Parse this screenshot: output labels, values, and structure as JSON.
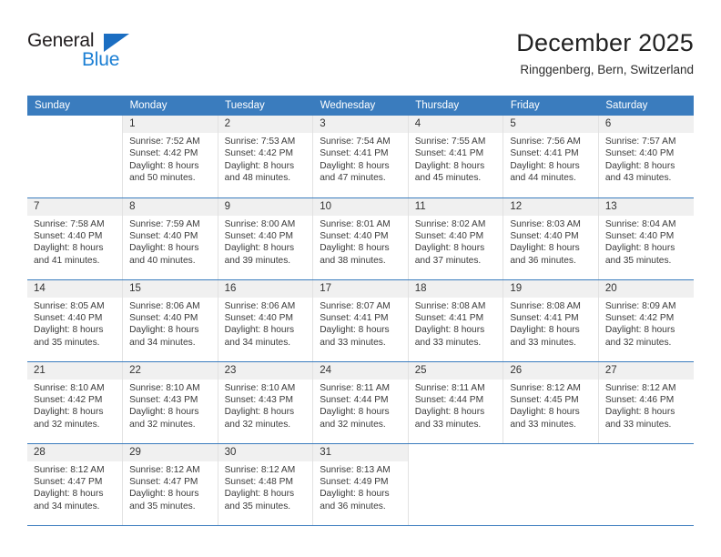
{
  "logo": {
    "word_one": "General",
    "word_two": "Blue",
    "triangle_icon": "triangle-icon",
    "color_dark": "#231f20",
    "color_blue": "#1b7fd4"
  },
  "header": {
    "title": "December 2025",
    "subtitle": "Ringgenberg, Bern, Switzerland"
  },
  "theme": {
    "header_bg": "#3a7cbe",
    "header_text": "#ffffff",
    "daynum_bg": "#f0f0f0",
    "cell_text": "#3a3a3a"
  },
  "weekday_headers": [
    "Sunday",
    "Monday",
    "Tuesday",
    "Wednesday",
    "Thursday",
    "Friday",
    "Saturday"
  ],
  "weeks": [
    [
      {
        "day": "",
        "lines": []
      },
      {
        "day": "1",
        "lines": [
          "Sunrise: 7:52 AM",
          "Sunset: 4:42 PM",
          "Daylight: 8 hours",
          "and 50 minutes."
        ]
      },
      {
        "day": "2",
        "lines": [
          "Sunrise: 7:53 AM",
          "Sunset: 4:42 PM",
          "Daylight: 8 hours",
          "and 48 minutes."
        ]
      },
      {
        "day": "3",
        "lines": [
          "Sunrise: 7:54 AM",
          "Sunset: 4:41 PM",
          "Daylight: 8 hours",
          "and 47 minutes."
        ]
      },
      {
        "day": "4",
        "lines": [
          "Sunrise: 7:55 AM",
          "Sunset: 4:41 PM",
          "Daylight: 8 hours",
          "and 45 minutes."
        ]
      },
      {
        "day": "5",
        "lines": [
          "Sunrise: 7:56 AM",
          "Sunset: 4:41 PM",
          "Daylight: 8 hours",
          "and 44 minutes."
        ]
      },
      {
        "day": "6",
        "lines": [
          "Sunrise: 7:57 AM",
          "Sunset: 4:40 PM",
          "Daylight: 8 hours",
          "and 43 minutes."
        ]
      }
    ],
    [
      {
        "day": "7",
        "lines": [
          "Sunrise: 7:58 AM",
          "Sunset: 4:40 PM",
          "Daylight: 8 hours",
          "and 41 minutes."
        ]
      },
      {
        "day": "8",
        "lines": [
          "Sunrise: 7:59 AM",
          "Sunset: 4:40 PM",
          "Daylight: 8 hours",
          "and 40 minutes."
        ]
      },
      {
        "day": "9",
        "lines": [
          "Sunrise: 8:00 AM",
          "Sunset: 4:40 PM",
          "Daylight: 8 hours",
          "and 39 minutes."
        ]
      },
      {
        "day": "10",
        "lines": [
          "Sunrise: 8:01 AM",
          "Sunset: 4:40 PM",
          "Daylight: 8 hours",
          "and 38 minutes."
        ]
      },
      {
        "day": "11",
        "lines": [
          "Sunrise: 8:02 AM",
          "Sunset: 4:40 PM",
          "Daylight: 8 hours",
          "and 37 minutes."
        ]
      },
      {
        "day": "12",
        "lines": [
          "Sunrise: 8:03 AM",
          "Sunset: 4:40 PM",
          "Daylight: 8 hours",
          "and 36 minutes."
        ]
      },
      {
        "day": "13",
        "lines": [
          "Sunrise: 8:04 AM",
          "Sunset: 4:40 PM",
          "Daylight: 8 hours",
          "and 35 minutes."
        ]
      }
    ],
    [
      {
        "day": "14",
        "lines": [
          "Sunrise: 8:05 AM",
          "Sunset: 4:40 PM",
          "Daylight: 8 hours",
          "and 35 minutes."
        ]
      },
      {
        "day": "15",
        "lines": [
          "Sunrise: 8:06 AM",
          "Sunset: 4:40 PM",
          "Daylight: 8 hours",
          "and 34 minutes."
        ]
      },
      {
        "day": "16",
        "lines": [
          "Sunrise: 8:06 AM",
          "Sunset: 4:40 PM",
          "Daylight: 8 hours",
          "and 34 minutes."
        ]
      },
      {
        "day": "17",
        "lines": [
          "Sunrise: 8:07 AM",
          "Sunset: 4:41 PM",
          "Daylight: 8 hours",
          "and 33 minutes."
        ]
      },
      {
        "day": "18",
        "lines": [
          "Sunrise: 8:08 AM",
          "Sunset: 4:41 PM",
          "Daylight: 8 hours",
          "and 33 minutes."
        ]
      },
      {
        "day": "19",
        "lines": [
          "Sunrise: 8:08 AM",
          "Sunset: 4:41 PM",
          "Daylight: 8 hours",
          "and 33 minutes."
        ]
      },
      {
        "day": "20",
        "lines": [
          "Sunrise: 8:09 AM",
          "Sunset: 4:42 PM",
          "Daylight: 8 hours",
          "and 32 minutes."
        ]
      }
    ],
    [
      {
        "day": "21",
        "lines": [
          "Sunrise: 8:10 AM",
          "Sunset: 4:42 PM",
          "Daylight: 8 hours",
          "and 32 minutes."
        ]
      },
      {
        "day": "22",
        "lines": [
          "Sunrise: 8:10 AM",
          "Sunset: 4:43 PM",
          "Daylight: 8 hours",
          "and 32 minutes."
        ]
      },
      {
        "day": "23",
        "lines": [
          "Sunrise: 8:10 AM",
          "Sunset: 4:43 PM",
          "Daylight: 8 hours",
          "and 32 minutes."
        ]
      },
      {
        "day": "24",
        "lines": [
          "Sunrise: 8:11 AM",
          "Sunset: 4:44 PM",
          "Daylight: 8 hours",
          "and 32 minutes."
        ]
      },
      {
        "day": "25",
        "lines": [
          "Sunrise: 8:11 AM",
          "Sunset: 4:44 PM",
          "Daylight: 8 hours",
          "and 33 minutes."
        ]
      },
      {
        "day": "26",
        "lines": [
          "Sunrise: 8:12 AM",
          "Sunset: 4:45 PM",
          "Daylight: 8 hours",
          "and 33 minutes."
        ]
      },
      {
        "day": "27",
        "lines": [
          "Sunrise: 8:12 AM",
          "Sunset: 4:46 PM",
          "Daylight: 8 hours",
          "and 33 minutes."
        ]
      }
    ],
    [
      {
        "day": "28",
        "lines": [
          "Sunrise: 8:12 AM",
          "Sunset: 4:47 PM",
          "Daylight: 8 hours",
          "and 34 minutes."
        ]
      },
      {
        "day": "29",
        "lines": [
          "Sunrise: 8:12 AM",
          "Sunset: 4:47 PM",
          "Daylight: 8 hours",
          "and 35 minutes."
        ]
      },
      {
        "day": "30",
        "lines": [
          "Sunrise: 8:12 AM",
          "Sunset: 4:48 PM",
          "Daylight: 8 hours",
          "and 35 minutes."
        ]
      },
      {
        "day": "31",
        "lines": [
          "Sunrise: 8:13 AM",
          "Sunset: 4:49 PM",
          "Daylight: 8 hours",
          "and 36 minutes."
        ]
      },
      {
        "day": "",
        "lines": []
      },
      {
        "day": "",
        "lines": []
      },
      {
        "day": "",
        "lines": []
      }
    ]
  ]
}
